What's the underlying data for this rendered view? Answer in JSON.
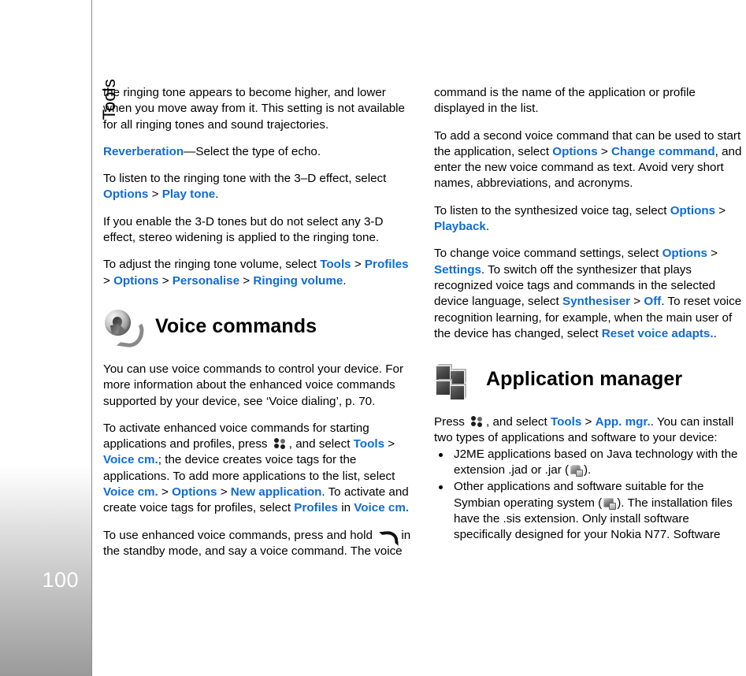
{
  "sidebar": {
    "chapter_label": "Tools",
    "page_number": "100"
  },
  "left_column": {
    "paragraphs": [
      {
        "id": "p-ringing-tone-higher",
        "runs": [
          {
            "t": "the ringing tone appears to become higher, and lower when you move away from it. This setting is not available for all ringing tones and sound trajectories.",
            "style": "plain"
          }
        ]
      },
      {
        "id": "p-reverberation",
        "runs": [
          {
            "t": "Reverberation",
            "style": "link"
          },
          {
            "t": "—Select the type of echo.",
            "style": "plain"
          }
        ]
      },
      {
        "id": "p-listen-3d",
        "runs": [
          {
            "t": "To listen to the ringing tone with the 3–D effect, select ",
            "style": "plain"
          },
          {
            "t": "Options",
            "style": "link"
          },
          {
            "t": " > ",
            "style": "plain"
          },
          {
            "t": "Play tone",
            "style": "link"
          },
          {
            "t": ".",
            "style": "plain"
          }
        ]
      },
      {
        "id": "p-stereo-widening",
        "runs": [
          {
            "t": "If you enable the 3-D tones but do not select any 3-D effect, stereo widening is applied to the ringing tone.",
            "style": "plain"
          }
        ]
      },
      {
        "id": "p-adjust-volume",
        "runs": [
          {
            "t": "To adjust the ringing tone volume, select ",
            "style": "plain"
          },
          {
            "t": "Tools",
            "style": "link"
          },
          {
            "t": " > ",
            "style": "plain"
          },
          {
            "t": "Profiles",
            "style": "link"
          },
          {
            "t": " > ",
            "style": "plain"
          },
          {
            "t": "Options",
            "style": "link"
          },
          {
            "t": " > ",
            "style": "plain"
          },
          {
            "t": "Personalise",
            "style": "link"
          },
          {
            "t": " > ",
            "style": "plain"
          },
          {
            "t": "Ringing volume",
            "style": "link"
          },
          {
            "t": ".",
            "style": "plain"
          }
        ]
      }
    ],
    "section": {
      "icon": "voice-commands-icon",
      "title": "Voice commands"
    },
    "paragraphs_after": [
      {
        "id": "p-voice-intro",
        "runs": [
          {
            "t": "You can use voice commands to control your device. For more information about the enhanced voice commands supported by your device, see ‘Voice dialing’, p. 70.",
            "style": "plain"
          }
        ]
      },
      {
        "id": "p-activate-voice",
        "runs": [
          {
            "t": "To activate enhanced voice commands for starting applications and profiles, press ",
            "style": "plain"
          },
          {
            "t": "menu-key-icon",
            "style": "icon-menukey"
          },
          {
            "t": ", and select ",
            "style": "plain"
          },
          {
            "t": "Tools",
            "style": "link"
          },
          {
            "t": " > ",
            "style": "plain"
          },
          {
            "t": "Voice cm.",
            "style": "link"
          },
          {
            "t": "; the device creates voice tags for the applications. To add more applications to the list, select ",
            "style": "plain"
          },
          {
            "t": "Voice cm.",
            "style": "link"
          },
          {
            "t": " > ",
            "style": "plain"
          },
          {
            "t": "Options",
            "style": "link"
          },
          {
            "t": " > ",
            "style": "plain"
          },
          {
            "t": "New application",
            "style": "link"
          },
          {
            "t": ". To activate and create voice tags for profiles, select ",
            "style": "plain"
          },
          {
            "t": "Profiles",
            "style": "link"
          },
          {
            "t": " in ",
            "style": "plain"
          },
          {
            "t": "Voice cm.",
            "style": "link"
          }
        ]
      },
      {
        "id": "p-use-voice",
        "runs": [
          {
            "t": "To use enhanced voice commands, press and hold ",
            "style": "plain"
          },
          {
            "t": "call-key-icon",
            "style": "icon-callkey"
          },
          {
            "t": " in the standby mode, and say a voice command. The voice",
            "style": "plain"
          }
        ]
      }
    ]
  },
  "right_column": {
    "paragraphs": [
      {
        "id": "p-command-name",
        "runs": [
          {
            "t": "command is the name of the application or profile displayed in the list.",
            "style": "plain"
          }
        ]
      },
      {
        "id": "p-add-second-command",
        "runs": [
          {
            "t": "To add a second voice command that can be used to start the application, select ",
            "style": "plain"
          },
          {
            "t": "Options",
            "style": "link"
          },
          {
            "t": " > ",
            "style": "plain"
          },
          {
            "t": "Change command",
            "style": "link"
          },
          {
            "t": ", and enter the new voice command as text. Avoid very short names, abbreviations, and acronyms.",
            "style": "plain"
          }
        ]
      },
      {
        "id": "p-listen-synth",
        "runs": [
          {
            "t": "To listen to the synthesized voice tag, select ",
            "style": "plain"
          },
          {
            "t": "Options",
            "style": "link"
          },
          {
            "t": " > ",
            "style": "plain"
          },
          {
            "t": "Playback",
            "style": "link"
          },
          {
            "t": ".",
            "style": "plain"
          }
        ]
      },
      {
        "id": "p-change-settings",
        "runs": [
          {
            "t": "To change voice command settings, select ",
            "style": "plain"
          },
          {
            "t": "Options",
            "style": "link"
          },
          {
            "t": " > ",
            "style": "plain"
          },
          {
            "t": "Settings",
            "style": "link"
          },
          {
            "t": ". To switch off the synthesizer that plays recognized voice tags and commands in the selected device language, select ",
            "style": "plain"
          },
          {
            "t": "Synthesiser",
            "style": "link"
          },
          {
            "t": " > ",
            "style": "plain"
          },
          {
            "t": "Off",
            "style": "link"
          },
          {
            "t": ". To reset voice recognition learning, for example, when the main user of the device has changed, select ",
            "style": "plain"
          },
          {
            "t": "Reset voice adapts.",
            "style": "link"
          },
          {
            "t": ".",
            "style": "plain"
          }
        ]
      }
    ],
    "section": {
      "icon": "application-manager-icon",
      "title": "Application manager"
    },
    "paragraphs_after": [
      {
        "id": "p-press-appmgr",
        "runs": [
          {
            "t": "Press ",
            "style": "plain"
          },
          {
            "t": "menu-key-icon",
            "style": "icon-menukey"
          },
          {
            "t": ", and select ",
            "style": "plain"
          },
          {
            "t": "Tools",
            "style": "link"
          },
          {
            "t": " > ",
            "style": "plain"
          },
          {
            "t": "App. mgr.",
            "style": "link"
          },
          {
            "t": ". You can install two types of applications and software to your device:",
            "style": "plain"
          }
        ]
      }
    ],
    "bullets": [
      {
        "id": "bullet-j2me",
        "runs": [
          {
            "t": "J2ME applications based on Java technology with the extension .jad or .jar (",
            "style": "plain"
          },
          {
            "t": "java-app-icon",
            "style": "icon-java"
          },
          {
            "t": ").",
            "style": "plain"
          }
        ]
      },
      {
        "id": "bullet-symbian",
        "runs": [
          {
            "t": "Other applications and software suitable for the Symbian operating system (",
            "style": "plain"
          },
          {
            "t": "symbian-app-icon",
            "style": "icon-symbian"
          },
          {
            "t": "). The installation files have the .sis extension. Only install software specifically designed for your Nokia N77. Software",
            "style": "plain"
          }
        ]
      }
    ]
  },
  "colors": {
    "link_blue": "#0f6cd4",
    "text_black": "#000000",
    "sidebar_border": "#8c8c8c",
    "page_number_text": "#ffffff"
  }
}
